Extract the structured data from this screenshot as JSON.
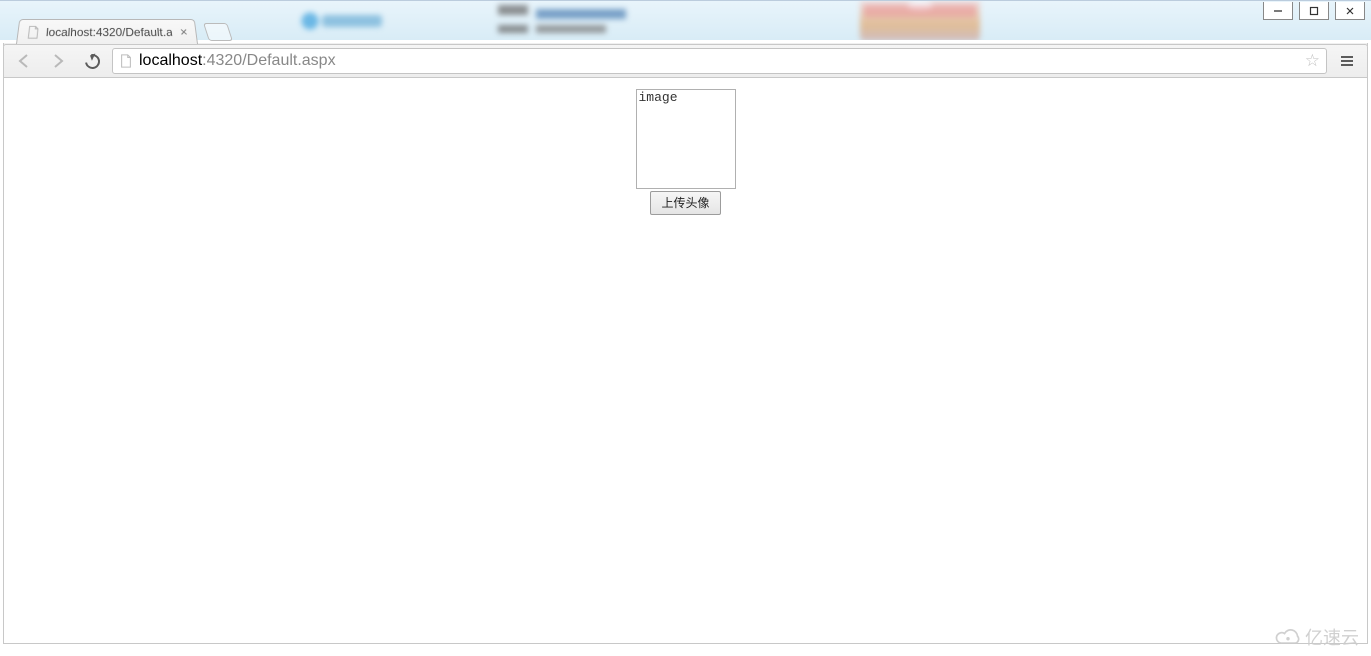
{
  "window": {
    "controls": {
      "min": "—",
      "max": "❐",
      "close": "✕"
    }
  },
  "tab": {
    "title": "localhost:4320/Default.a",
    "close": "×"
  },
  "url": {
    "host": "localhost",
    "rest": ":4320/Default.aspx"
  },
  "page": {
    "image_alt": "image",
    "upload_button": "上传头像"
  },
  "watermark": {
    "text": "亿速云"
  }
}
